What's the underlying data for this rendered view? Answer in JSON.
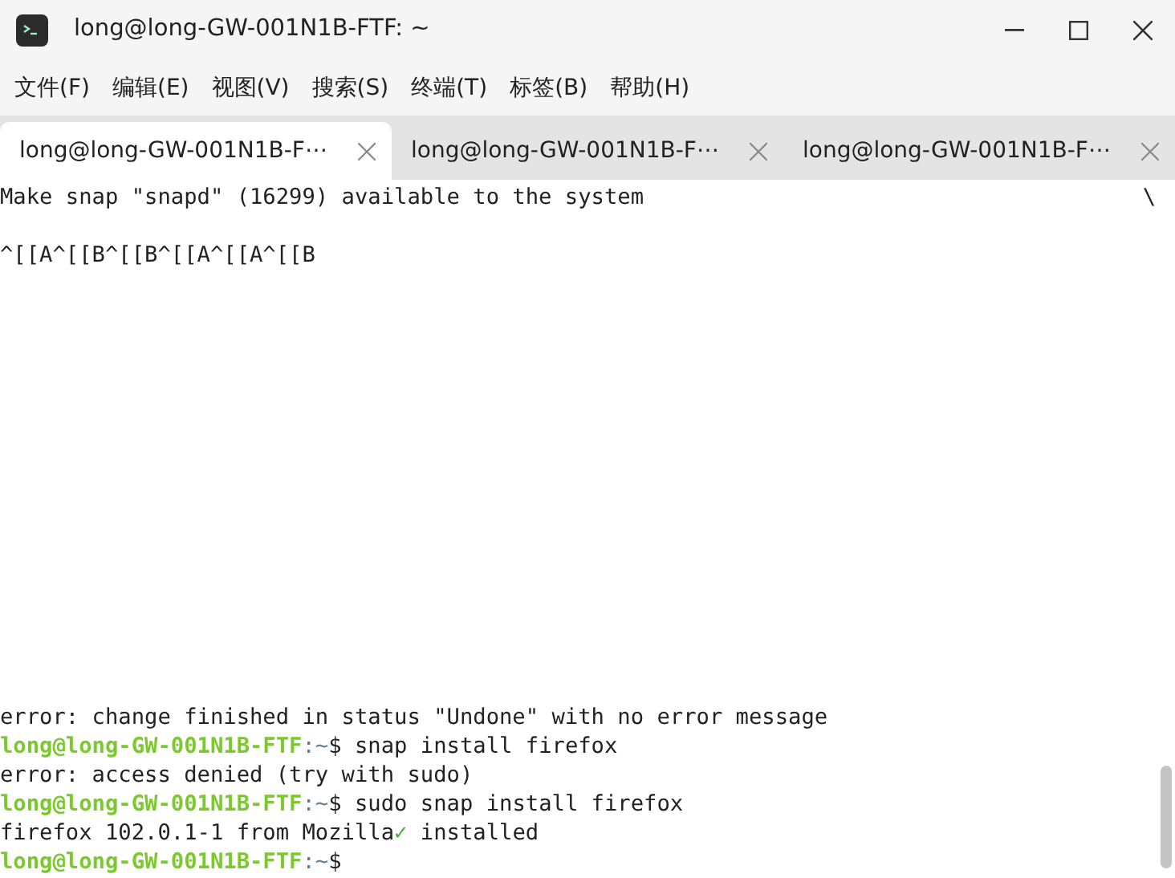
{
  "window": {
    "title": "long@long-GW-001N1B-FTF: ~"
  },
  "menu": [
    "文件(F)",
    "编辑(E)",
    "视图(V)",
    "搜索(S)",
    "终端(T)",
    "标签(B)",
    "帮助(H)"
  ],
  "tabs": [
    {
      "label": "long@long-GW-001N1B-F⋯",
      "selected": true
    },
    {
      "label": "long@long-GW-001N1B-F⋯",
      "selected": false
    },
    {
      "label": "long@long-GW-001N1B-F⋯",
      "selected": false
    }
  ],
  "terminal": {
    "top_lines": [
      [
        {
          "kind": "plain",
          "text": "Make snap \"snapd\" (16299) available to the system"
        },
        {
          "kind": "edge",
          "text": "\\"
        }
      ],
      [
        {
          "kind": "plain",
          "text": "^[[A^[[B^[[B^[[A^[[A^[[B"
        }
      ]
    ],
    "bottom_lines": [
      [
        {
          "kind": "plain",
          "text": "error: change finished in status \"Undone\" with no error message"
        }
      ],
      [
        {
          "kind": "host",
          "text": "long@long-GW-001N1B-FTF"
        },
        {
          "kind": "path",
          "text": ":~"
        },
        {
          "kind": "plain",
          "text": "$ snap install firefox"
        }
      ],
      [
        {
          "kind": "plain",
          "text": "error: access denied (try with sudo)"
        }
      ],
      [
        {
          "kind": "host",
          "text": "long@long-GW-001N1B-FTF"
        },
        {
          "kind": "path",
          "text": ":~"
        },
        {
          "kind": "plain",
          "text": "$ sudo snap install firefox"
        }
      ],
      [
        {
          "kind": "plain",
          "text": "firefox 102.0.1-1 from Mozilla"
        },
        {
          "kind": "check",
          "text": "✓"
        },
        {
          "kind": "plain",
          "text": " installed"
        }
      ],
      [
        {
          "kind": "host",
          "text": "long@long-GW-001N1B-FTF"
        },
        {
          "kind": "path",
          "text": ":~"
        },
        {
          "kind": "plain",
          "text": "$"
        }
      ]
    ]
  }
}
